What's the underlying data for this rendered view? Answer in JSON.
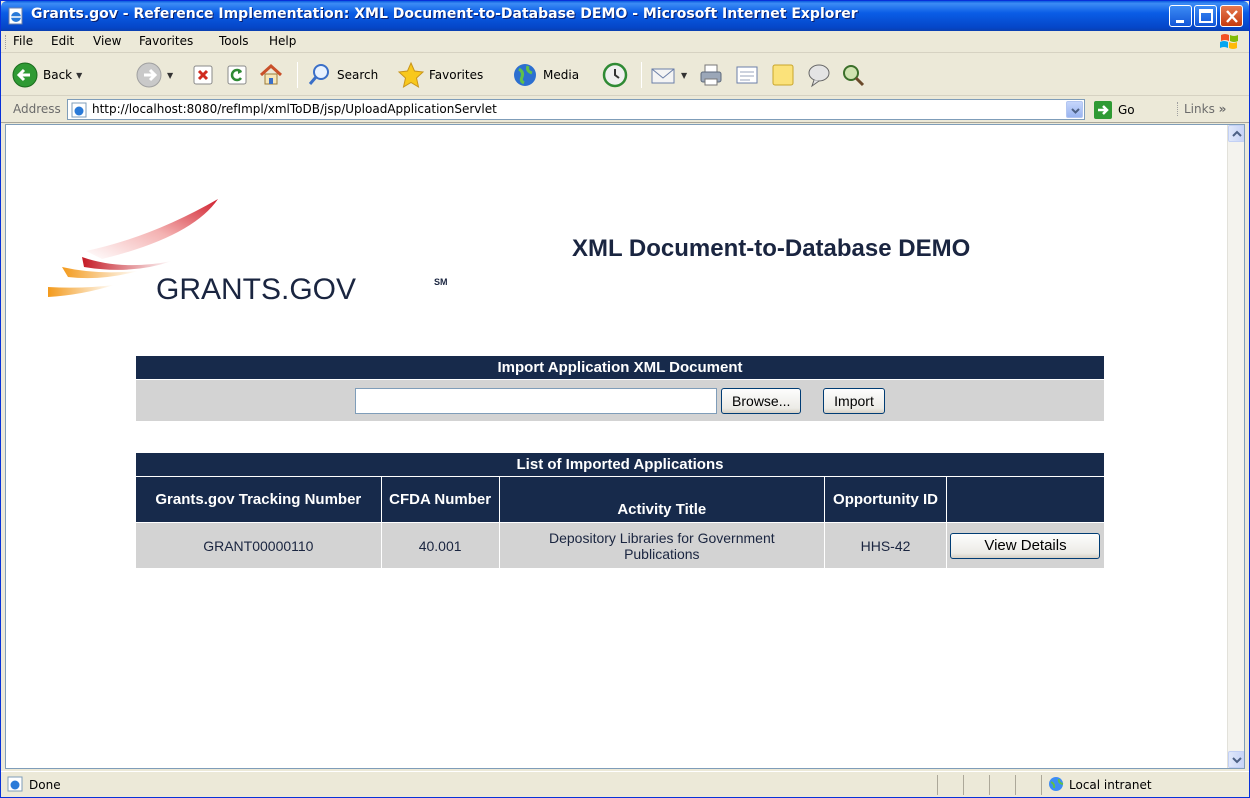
{
  "window": {
    "title": "Grants.gov - Reference Implementation: XML Document-to-Database DEMO - Microsoft Internet Explorer"
  },
  "menubar": {
    "items": [
      "File",
      "Edit",
      "View",
      "Favorites",
      "Tools",
      "Help"
    ]
  },
  "toolbar": {
    "back_label": "Back",
    "search_label": "Search",
    "favorites_label": "Favorites",
    "media_label": "Media"
  },
  "addressbar": {
    "label": "Address",
    "url": "http://localhost:8080/refImpl/xmlToDB/jsp/UploadApplicationServlet",
    "go_label": "Go",
    "links_label": "Links"
  },
  "page": {
    "logo_text": "GRANTS.GOV",
    "logo_mark": "SM",
    "heading": "XML Document-to-Database DEMO",
    "import_panel": {
      "title": "Import Application XML Document",
      "file_value": "",
      "browse_label": "Browse...",
      "import_label": "Import"
    },
    "apps_panel": {
      "title": "List of Imported Applications",
      "columns": [
        "Grants.gov Tracking Number",
        "CFDA Number",
        "Activity Title",
        "Opportunity ID",
        ""
      ],
      "rows": [
        {
          "tracking_number": "GRANT00000110",
          "cfda_number": "40.001",
          "activity_title": "Depository Libraries for Government Publications",
          "opportunity_id": "HHS-42",
          "action_label": "View Details"
        }
      ]
    }
  },
  "statusbar": {
    "text": "Done",
    "zone": "Local intranet"
  },
  "colors": {
    "panel_header": "#172a4b",
    "panel_body": "#d3d3d3",
    "logo_red": "#d0202e",
    "logo_orange": "#f39a1c",
    "logo_navy": "#1a2540"
  }
}
